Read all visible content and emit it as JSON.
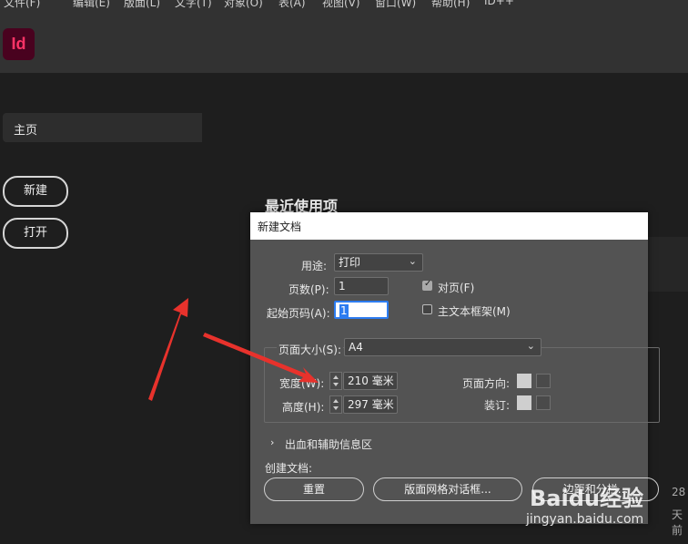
{
  "menu": [
    "文件(F)",
    "编辑(E)",
    "版面(L)",
    "文字(T)",
    "对象(O)",
    "表(A)",
    "视图(V)",
    "窗口(W)",
    "帮助(H)",
    "ID++"
  ],
  "app": {
    "logo_text": "Id",
    "brand_color": "#ff3366"
  },
  "sidebar": {
    "home_tab": "主页",
    "new_button": "新建",
    "open_button": "打开"
  },
  "main": {
    "recent_heading": "最近使用项",
    "side_text_1": "28",
    "side_text_2": "天前"
  },
  "dialog": {
    "title": "新建文档",
    "intent_label": "用途:",
    "intent_value": "打印",
    "pages_label": "页数(P):",
    "pages_value": "1",
    "start_label": "起始页码(A):",
    "start_value": "1",
    "facing_label": "对页(F)",
    "facing_checked": true,
    "master_frame_label": "主文本框架(M)",
    "master_frame_checked": false,
    "page_size_label": "页面大小(S):",
    "page_size_value": "A4",
    "width_label": "宽度(W):",
    "width_value": "210 毫米",
    "height_label": "高度(H):",
    "height_value": "297 毫米",
    "orientation_label": "页面方向:",
    "binding_label": "装订:",
    "bleed_section": "出血和辅助信息区",
    "create_label": "创建文档:",
    "reset_button": "重置",
    "grid_button": "版面网格对话框...",
    "margins_button": "边距和分栏..."
  },
  "watermark": {
    "brand": "Baidu经验",
    "url": "jingyan.baidu.com"
  },
  "colors": {
    "arrow": "#e8322c",
    "focus": "#2d7cf0"
  }
}
